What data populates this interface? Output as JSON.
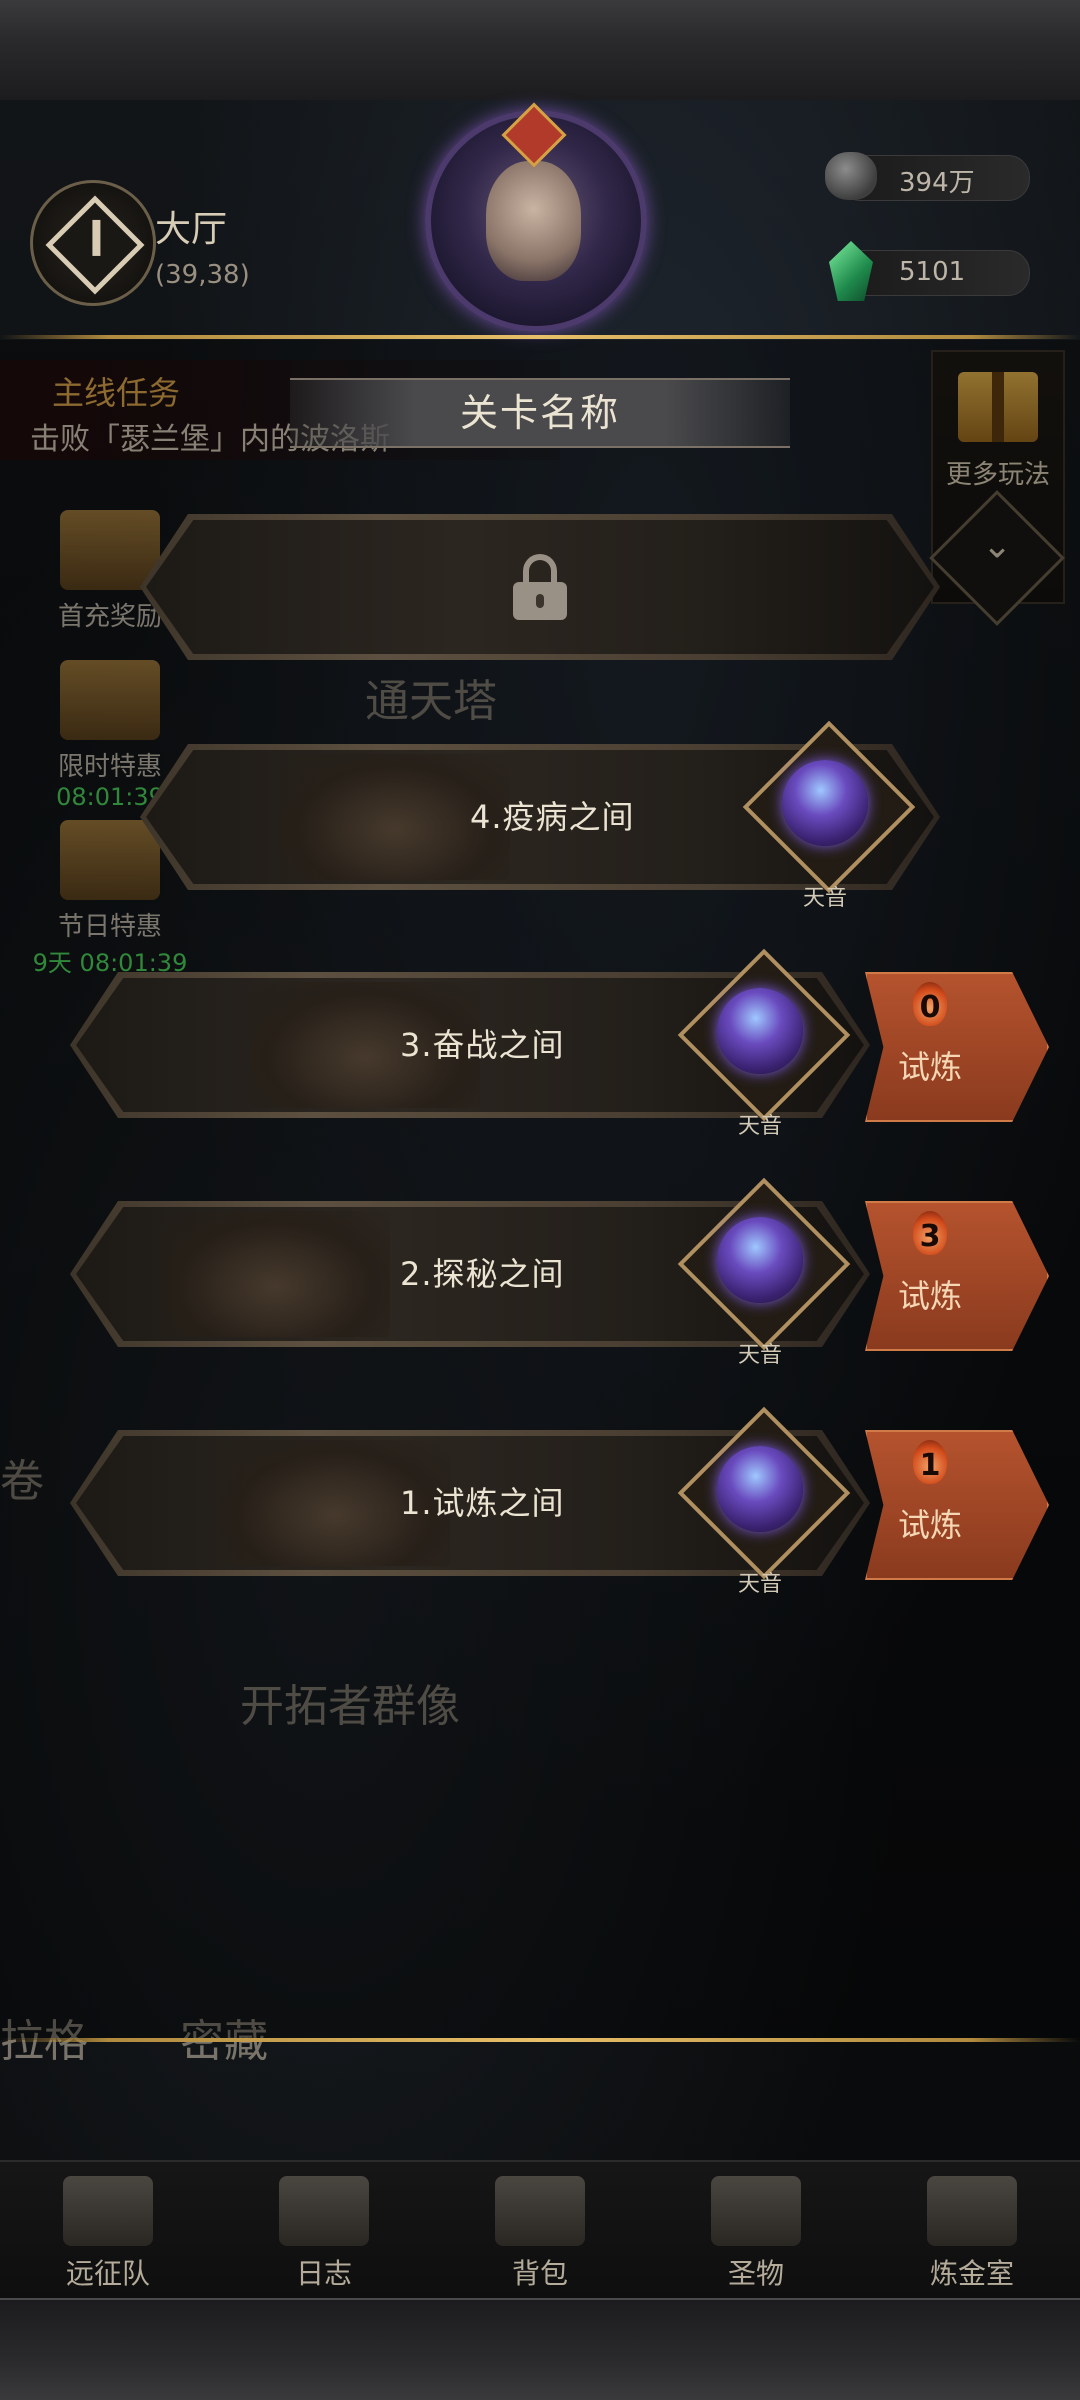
{
  "hud": {
    "location_name": "大厅",
    "location_coord": "(39,38)",
    "currency_ore": "394万",
    "currency_gem": "5101"
  },
  "quest": {
    "title": "主线任务",
    "desc": "击败「瑟兰堡」内的波洛斯"
  },
  "more_play_label": "更多玩法",
  "side_menu": [
    {
      "label": "首充奖励",
      "timer": ""
    },
    {
      "label": "限时特惠",
      "timer": "08:01:39"
    },
    {
      "label": "节日特惠",
      "timer": "9天 08:01:39"
    }
  ],
  "map_labels": {
    "tower": "通天塔",
    "statues": "开拓者群像",
    "secret": "密藏",
    "partial_left": "卷",
    "partial_bottom": "拉格"
  },
  "dialog": {
    "title": "关卡名称",
    "stages": [
      {
        "name": "4.疫病之间",
        "boss": "天音"
      },
      {
        "name": "3.奋战之间",
        "boss": "天音",
        "trial_count": "0",
        "trial_label": "试炼"
      },
      {
        "name": "2.探秘之间",
        "boss": "天音",
        "trial_count": "3",
        "trial_label": "试炼"
      },
      {
        "name": "1.试炼之间",
        "boss": "天音",
        "trial_count": "1",
        "trial_label": "试炼"
      }
    ]
  },
  "bottom_nav": [
    "远征队",
    "日志",
    "背包",
    "圣物",
    "炼金室"
  ],
  "colors": {
    "accent_gold": "#e8c06a",
    "trial_orange": "#b5532e",
    "timer_green": "#4bd15a"
  }
}
